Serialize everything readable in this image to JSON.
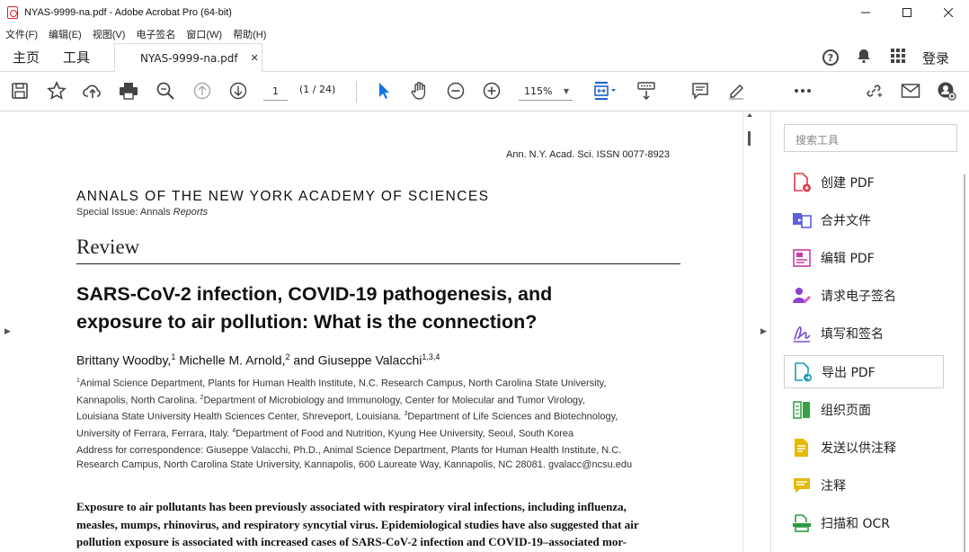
{
  "window": {
    "title": "NYAS-9999-na.pdf - Adobe Acrobat Pro (64-bit)"
  },
  "menu": [
    "文件(F)",
    "编辑(E)",
    "视图(V)",
    "电子签名",
    "窗口(W)",
    "帮助(H)"
  ],
  "tabs": {
    "home": "主页",
    "tools": "工具",
    "document": "NYAS-9999-na.pdf",
    "close_glyph": "✕",
    "login": "登录"
  },
  "toolbar": {
    "current_page": "1",
    "page_count": "(1 / 24)",
    "zoom": "115%"
  },
  "document": {
    "journal_ref": "Ann. N.Y. Acad. Sci. ISSN 0077-8923",
    "journal_name": "ANNALS OF THE NEW YORK ACADEMY OF SCIENCES",
    "special_issue_prefix": "Special Issue: Annals ",
    "special_issue_italic": "Reports",
    "section": "Review",
    "title_line1": "SARS-CoV-2 infection, COVID-19 pathogenesis, and",
    "title_line2": "exposure to air pollution: What is the connection?",
    "author1": "Brittany Woodby,",
    "author1_sup": "1",
    "author2": " Michelle M. Arnold,",
    "author2_sup": "2",
    "author3": " and Giuseppe Valacchi",
    "author3_sup": "1,3,4",
    "aff_sup1": "1",
    "aff1_line1": "Animal Science Department, Plants for Human Health Institute, N.C. Research Campus, North Carolina State University,",
    "aff1_line2a": "Kannapolis, North Carolina. ",
    "aff_sup2": "2",
    "aff1_line2b": "Department of Microbiology and Immunology, Center for Molecular and Tumor Virology,",
    "aff1_line3a": "Louisiana State University Health Sciences Center, Shreveport, Louisiana. ",
    "aff_sup3": "3",
    "aff1_line3b": "Department of Life Sciences and Biotechnology,",
    "aff1_line4a": "University of Ferrara, Ferrara, Italy. ",
    "aff_sup4": "4",
    "aff1_line4b": "Department of Food and Nutrition, Kyung Hee University, Seoul, South Korea",
    "addr_line1": "Address for correspondence: Giuseppe Valacchi, Ph.D., Animal Science Department, Plants for Human Health Institute, N.C.",
    "addr_line2": "Research Campus, North Carolina State University, Kannapolis, 600 Laureate Way, Kannapolis, NC 28081. gvalacc@ncsu.edu",
    "abs_line1": "Exposure to air pollutants has been previously associated with respiratory viral infections, including influenza,",
    "abs_line2": "measles, mumps, rhinovirus, and respiratory syncytial virus. Epidemiological studies have also suggested that air",
    "abs_line3": "pollution exposure is associated with increased cases of SARS-CoV-2 infection and COVID-19–associated mor-"
  },
  "tools_panel": {
    "search_placeholder": "搜索工具",
    "items": [
      {
        "label": "创建 PDF",
        "color": "#e0384b"
      },
      {
        "label": "合并文件",
        "color": "#5b5fe0"
      },
      {
        "label": "编辑 PDF",
        "color": "#c93aa6"
      },
      {
        "label": "请求电子签名",
        "color": "#8b3fd1"
      },
      {
        "label": "填写和签名",
        "color": "#7a4fd6"
      },
      {
        "label": "导出 PDF",
        "color": "#1b9bb3"
      },
      {
        "label": "组织页面",
        "color": "#3aa047"
      },
      {
        "label": "发送以供注释",
        "color": "#e6b800"
      },
      {
        "label": "注释",
        "color": "#e6b800"
      },
      {
        "label": "扫描和 OCR",
        "color": "#2e9a44"
      }
    ]
  }
}
